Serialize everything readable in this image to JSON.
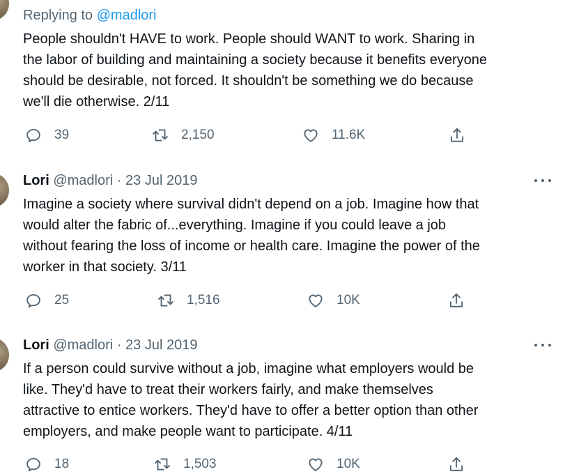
{
  "replying": {
    "prefix": "Replying to ",
    "mention": "@madlori"
  },
  "tweets": [
    {
      "text": "People shouldn't HAVE to work. People should WANT to work. Sharing in\nthe labor of building and maintaining a society because it benefits everyone\nshould be desirable, not forced. It shouldn't be something we do because\nwe'll die otherwise. 2/11",
      "replies": "39",
      "retweets": "2,150",
      "likes": "11.6K"
    },
    {
      "name": "Lori",
      "handle": "@madlori",
      "sep": "·",
      "date": "23 Jul 2019",
      "text": "Imagine a society where survival didn't depend on a job. Imagine how that\nwould alter the fabric of...everything. Imagine if you could leave a job\nwithout fearing the loss of income or health care. Imagine the power of the\nworker in that society. 3/11",
      "replies": "25",
      "retweets": "1,516",
      "likes": "10K"
    },
    {
      "name": "Lori",
      "handle": "@madlori",
      "sep": "·",
      "date": "23 Jul 2019",
      "text": "If a person could survive without a job, imagine what employers would be\nlike. They'd have to treat their workers fairly, and make themselves\nattractive to entice workers. They'd have to offer a better option than other\nemployers, and make people want to participate. 4/11",
      "replies": "18",
      "retweets": "1,503",
      "likes": "10K"
    }
  ],
  "icons": {
    "reply": "reply-icon",
    "retweet": "retweet-icon",
    "like": "heart-icon",
    "share": "share-icon",
    "more": "more-icon"
  },
  "colors": {
    "text": "#0f1419",
    "secondary": "#536471",
    "link": "#1d9bf0"
  }
}
